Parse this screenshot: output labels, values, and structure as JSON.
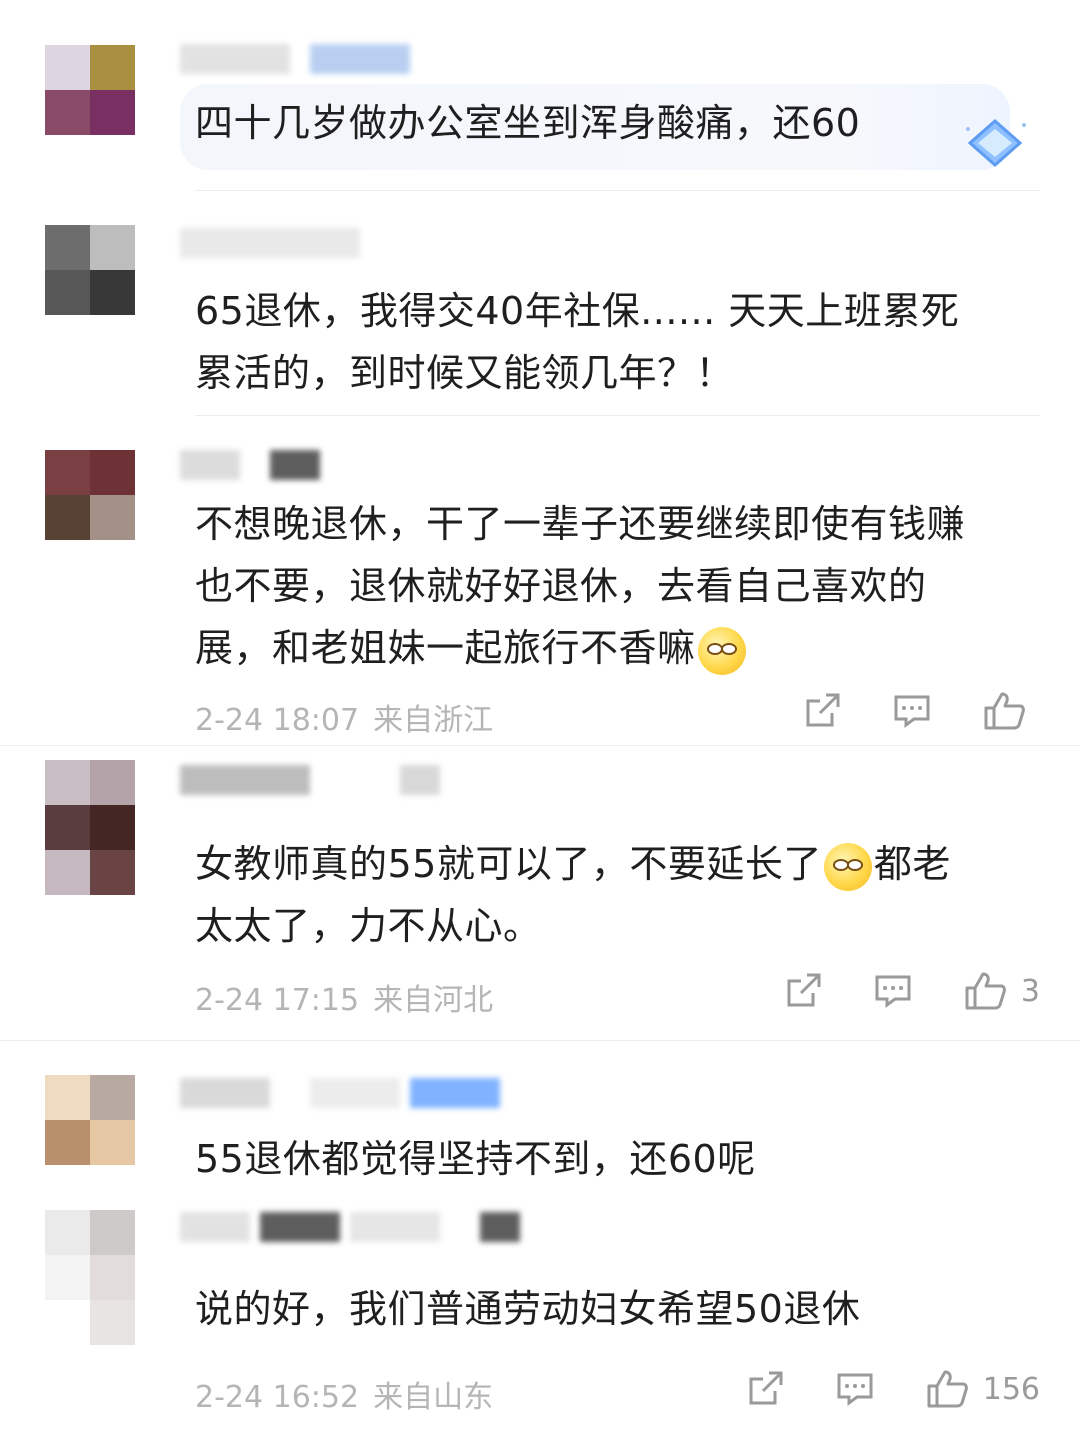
{
  "comments": [
    {
      "text_lines": [
        "四十几岁做办公室坐到浑身酸痛，还60"
      ],
      "has_badge": true
    },
    {
      "text_lines": [
        "65退休，我得交40年社保...... 天天上班累死",
        "累活的，到时候又能领几年？！"
      ]
    },
    {
      "text_lines": [
        "不想晚退休，干了一辈子还要继续即使有钱赚",
        "也不要，退休就好好退休，去看自己喜欢的",
        "展，和老姐妹一起旅行不香嘛"
      ],
      "emoji": "thinking-face-emoji",
      "time": "2-24 18:07",
      "location": "来自浙江",
      "likes": ""
    },
    {
      "text_lines_a": "女教师真的55就可以了，不要延长了",
      "text_lines_b": "都老",
      "text_line2": "太太了，力不从心。",
      "emoji": "rolling-eyes-emoji",
      "time": "2-24 17:15",
      "location": "来自河北",
      "likes": "3"
    },
    {
      "text_lines": [
        "55退休都觉得坚持不到，还60呢"
      ]
    },
    {
      "text_lines": [
        "说的好，我们普通劳动妇女希望50退休"
      ],
      "time": "2-24 16:52",
      "location": "来自山东",
      "likes": "156"
    }
  ],
  "icons": {
    "share": "share-icon",
    "reply": "comment-icon",
    "like": "thumbs-up-icon"
  },
  "colors": {
    "text": "#1f1f1f",
    "meta": "#b5b5b5",
    "icon": "#9a9a9a",
    "badge": "#7fb3ff"
  }
}
